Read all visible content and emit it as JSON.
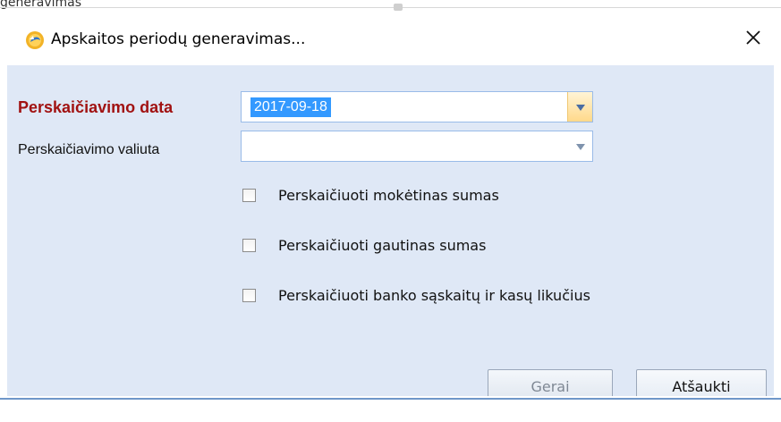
{
  "window": {
    "partial_top_text": "generavimas",
    "title": "Apskaitos periodų generavimas...",
    "app_icon": "app-logo-icon",
    "close_icon": "close-icon"
  },
  "form": {
    "date_label": "Perskaičiavimo data",
    "date_value": "2017-09-18",
    "currency_label": "Perskaičiavimo valiuta",
    "currency_value": ""
  },
  "options": [
    {
      "label": "Perskaičiuoti mokėtinas sumas",
      "checked": false
    },
    {
      "label": "Perskaičiuoti gautinas sumas",
      "checked": false
    },
    {
      "label": "Perskaičiuoti banko sąskaitų ir kasų likučius",
      "checked": false
    }
  ],
  "buttons": {
    "ok": "Gerai",
    "cancel": "Atšaukti"
  },
  "colors": {
    "required_label": "#a11212",
    "client_background": "#dfe8f6",
    "field_border": "#99bbe8",
    "selection": "#3399ff",
    "active_dropdown": "#ffd98a",
    "bottom_line": "#6f97c9"
  }
}
